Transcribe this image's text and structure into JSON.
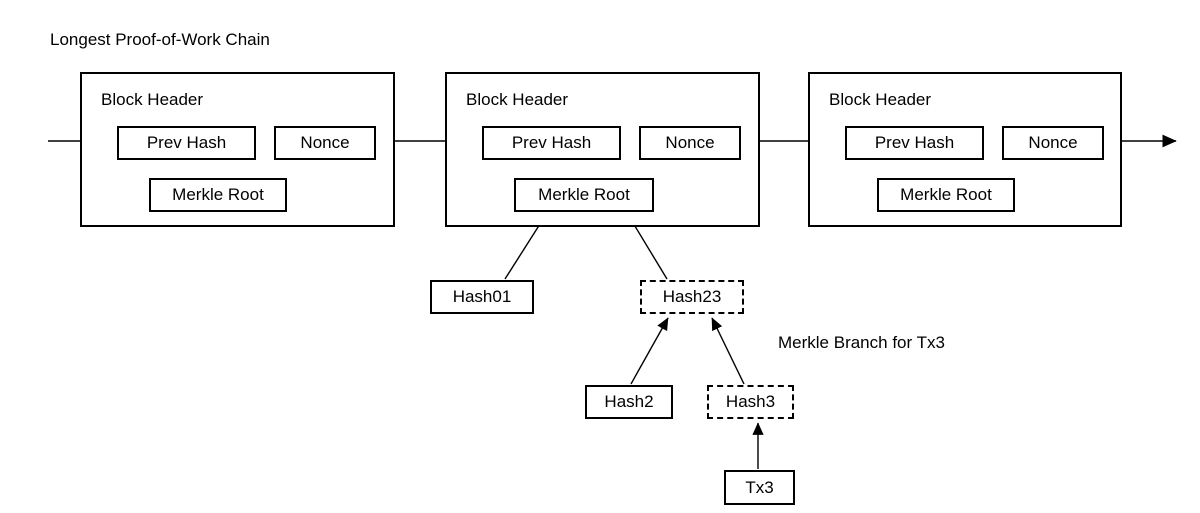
{
  "diagram": {
    "title": "Longest Proof-of-Work Chain",
    "annotation": "Merkle Branch for Tx3",
    "stroke_color": "#000000",
    "background_color": "#ffffff",
    "blocks": [
      {
        "id": "block-1",
        "header_label": "Block Header",
        "fields": {
          "prev_hash": "Prev Hash",
          "nonce": "Nonce",
          "merkle_root": "Merkle Root"
        }
      },
      {
        "id": "block-2",
        "header_label": "Block Header",
        "fields": {
          "prev_hash": "Prev Hash",
          "nonce": "Nonce",
          "merkle_root": "Merkle Root"
        }
      },
      {
        "id": "block-3",
        "header_label": "Block Header",
        "fields": {
          "prev_hash": "Prev Hash",
          "nonce": "Nonce",
          "merkle_root": "Merkle Root"
        }
      }
    ],
    "merkle_nodes": [
      {
        "id": "hash01",
        "label": "Hash01",
        "border": "solid"
      },
      {
        "id": "hash23",
        "label": "Hash23",
        "border": "dashed"
      },
      {
        "id": "hash2",
        "label": "Hash2",
        "border": "solid"
      },
      {
        "id": "hash3",
        "label": "Hash3",
        "border": "dashed"
      },
      {
        "id": "tx3",
        "label": "Tx3",
        "border": "solid"
      }
    ]
  }
}
